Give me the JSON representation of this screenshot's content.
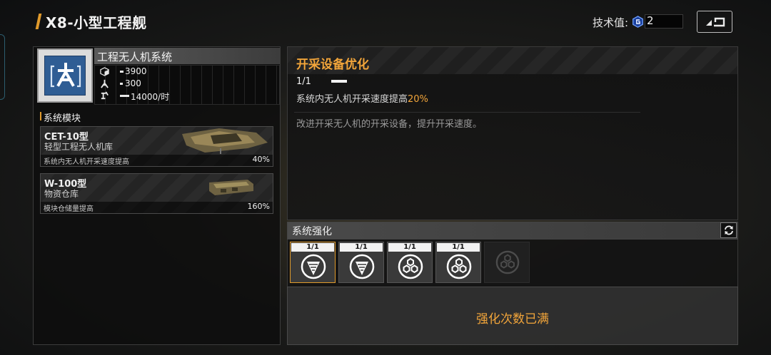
{
  "header": {
    "title": "X8-小型工程舰",
    "tech_label": "技术值:",
    "tech_value": "2"
  },
  "system": {
    "name": "工程无人机系统",
    "stats": [
      {
        "icon": "cube-icon",
        "value": "3900",
        "fill": 0.05
      },
      {
        "icon": "drone-icon",
        "value": "300",
        "fill": 0.04
      },
      {
        "icon": "mining-icon",
        "value": "14000/时",
        "fill": 0.22
      }
    ],
    "modules_title": "系统模块",
    "modules": [
      {
        "name": "CET-10型",
        "subtitle": "轻型工程无人机库",
        "desc": "系统内无人机开采速度提高",
        "value": "40%"
      },
      {
        "name": "W-100型",
        "subtitle": "物资仓库",
        "desc": "模块仓储量提高",
        "value": "160%"
      }
    ]
  },
  "upgrade": {
    "title": "开采设备优化",
    "level": "1/1",
    "effect_prefix": "系统内无人机开采速度提高",
    "effect_value": "20%",
    "description": "改进开采无人机的开采设备，提升开采速度。"
  },
  "enhance": {
    "title": "系统强化",
    "slots": [
      {
        "count": "1/1",
        "icon": "drill-icon",
        "selected": true
      },
      {
        "count": "1/1",
        "icon": "drill-icon",
        "selected": false
      },
      {
        "count": "1/1",
        "icon": "hexagon-cluster-icon",
        "selected": false
      },
      {
        "count": "1/1",
        "icon": "hexagon-cluster-icon",
        "selected": false
      }
    ],
    "locked_icon": "hexagon-cluster-icon",
    "status": "强化次数已满"
  },
  "colors": {
    "accent": "#f2a53a",
    "icon_blue": "#2f5d94"
  }
}
